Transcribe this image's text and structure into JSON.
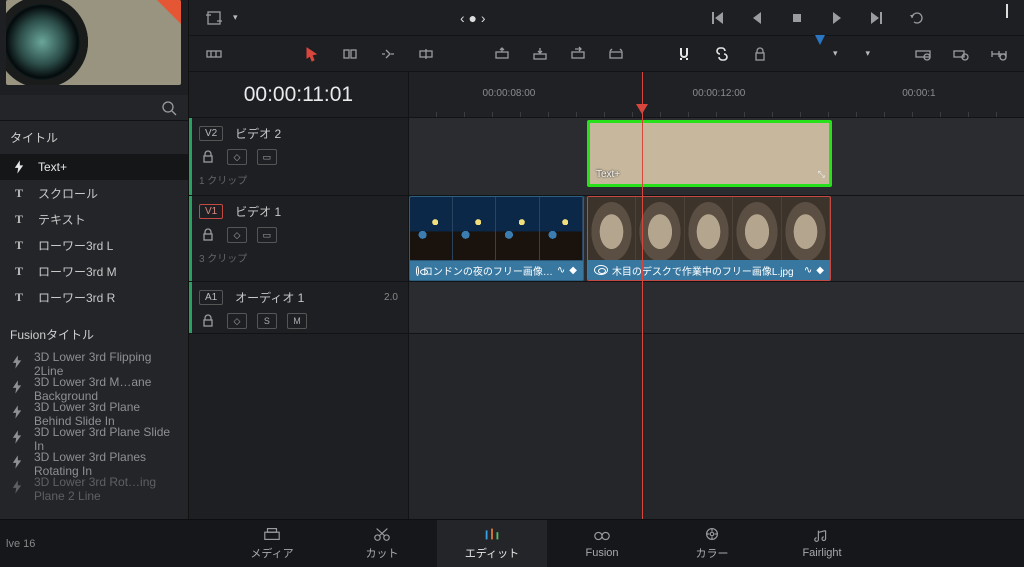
{
  "sidebar": {
    "search_tooltip": "検索",
    "section_titles": "タイトル",
    "titles": [
      {
        "label": "Text+",
        "icon": "bolt",
        "selected": true
      },
      {
        "label": "スクロール",
        "icon": "T"
      },
      {
        "label": "テキスト",
        "icon": "T"
      },
      {
        "label": "ローワー3rd L",
        "icon": "T"
      },
      {
        "label": "ローワー3rd M",
        "icon": "T"
      },
      {
        "label": "ローワー3rd R",
        "icon": "T"
      }
    ],
    "section_fusion": "Fusionタイトル",
    "fusion": [
      "3D Lower 3rd Flipping 2Line",
      "3D Lower 3rd M…ane Background",
      "3D Lower 3rd Plane Behind Slide In",
      "3D Lower 3rd Plane Slide In",
      "3D Lower 3rd Planes Rotating In",
      "3D Lower 3rd Rot…ing Plane 2 Line"
    ]
  },
  "timecode": "00:00:11:01",
  "ruler": {
    "labels": [
      "00:00:08:00",
      "00:00:12:00",
      "00:00:1"
    ],
    "positions": [
      100,
      310,
      520
    ]
  },
  "tracks": {
    "v2": {
      "badge": "V2",
      "name": "ビデオ 2",
      "sub": "1 クリップ"
    },
    "v1": {
      "badge": "V1",
      "name": "ビデオ 1",
      "sub": "3 クリップ"
    },
    "a1": {
      "badge": "A1",
      "name": "オーディオ 1",
      "level": "2.0"
    }
  },
  "clips": {
    "textplus": "Text+",
    "london": "ロンドンの夜のフリー画像…",
    "desk": "木目のデスクで作業中のフリー画像L.jpg"
  },
  "nav": {
    "media": "メディア",
    "cut": "カット",
    "edit": "エディット",
    "fusion": "Fusion",
    "color": "カラー",
    "fairlight": "Fairlight"
  },
  "version": "lve 16"
}
